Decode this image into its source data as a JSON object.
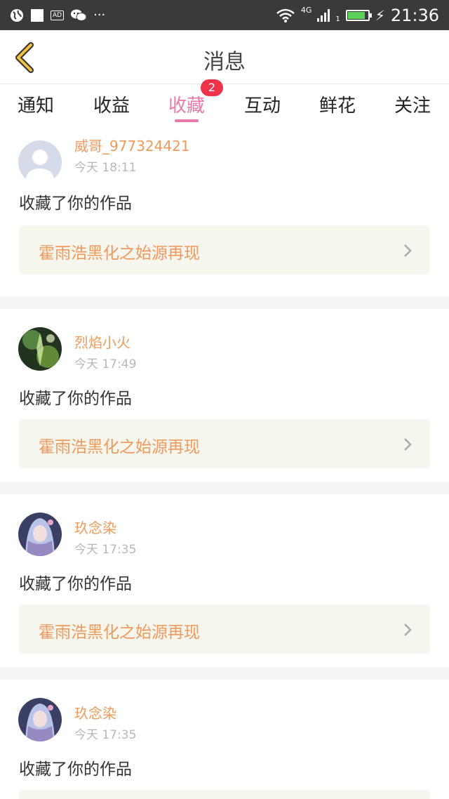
{
  "status_bar": {
    "time": "21:36",
    "network": "4G",
    "sim": "1",
    "battery_level": 0.85,
    "icons": [
      "globe-icon",
      "square-icon",
      "ad-icon",
      "wechat-icon",
      "more-icon",
      "wifi-icon",
      "signal-icon",
      "battery-icon",
      "charging-icon"
    ]
  },
  "nav": {
    "title": "消息",
    "back_icon": "chevron-left-icon",
    "accent": "#f0c040"
  },
  "tabs": {
    "items": [
      {
        "label": "通知"
      },
      {
        "label": "收益"
      },
      {
        "label": "收藏"
      },
      {
        "label": "互动"
      },
      {
        "label": "鲜花"
      },
      {
        "label": "关注"
      }
    ],
    "active_index": 2,
    "active_color": "#e879a8",
    "badge": "2"
  },
  "messages": [
    {
      "name": "威哥_977324421",
      "time": "今天 18:11",
      "action": "收藏了你的作品",
      "work": "霍雨浩黑化之始源再现",
      "avatar": "default-avatar-icon"
    },
    {
      "name": "烈焰小火",
      "time": "今天 17:49",
      "action": "收藏了你的作品",
      "work": "霍雨浩黑化之始源再现",
      "avatar": "user-avatar-green"
    },
    {
      "name": "玖念染",
      "time": "今天 17:35",
      "action": "收藏了你的作品",
      "work": "霍雨浩黑化之始源再现",
      "avatar": "user-avatar-anime"
    },
    {
      "name": "玖念染",
      "time": "今天 17:35",
      "action": "收藏了你的作品",
      "work": "",
      "avatar": "user-avatar-anime"
    }
  ],
  "colors": {
    "name": "#ef9a5b",
    "card_bg": "#f6f5ee",
    "badge": "#f0334b"
  }
}
